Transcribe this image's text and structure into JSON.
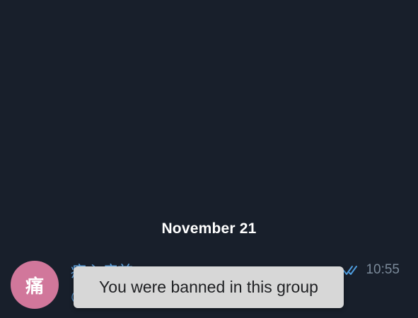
{
  "date_separator": "November 21",
  "message": {
    "avatar_letter": "痛",
    "sender_name": "痛心疾首",
    "time": "10:55",
    "status_icon": "double-check-icon"
  },
  "toast": {
    "text": "You were banned in this group"
  },
  "colors": {
    "background": "#181f2b",
    "avatar": "#d1779b",
    "sender": "#63a9e8",
    "check": "#4f9ee0",
    "toast_bg": "#d7d7d7"
  }
}
